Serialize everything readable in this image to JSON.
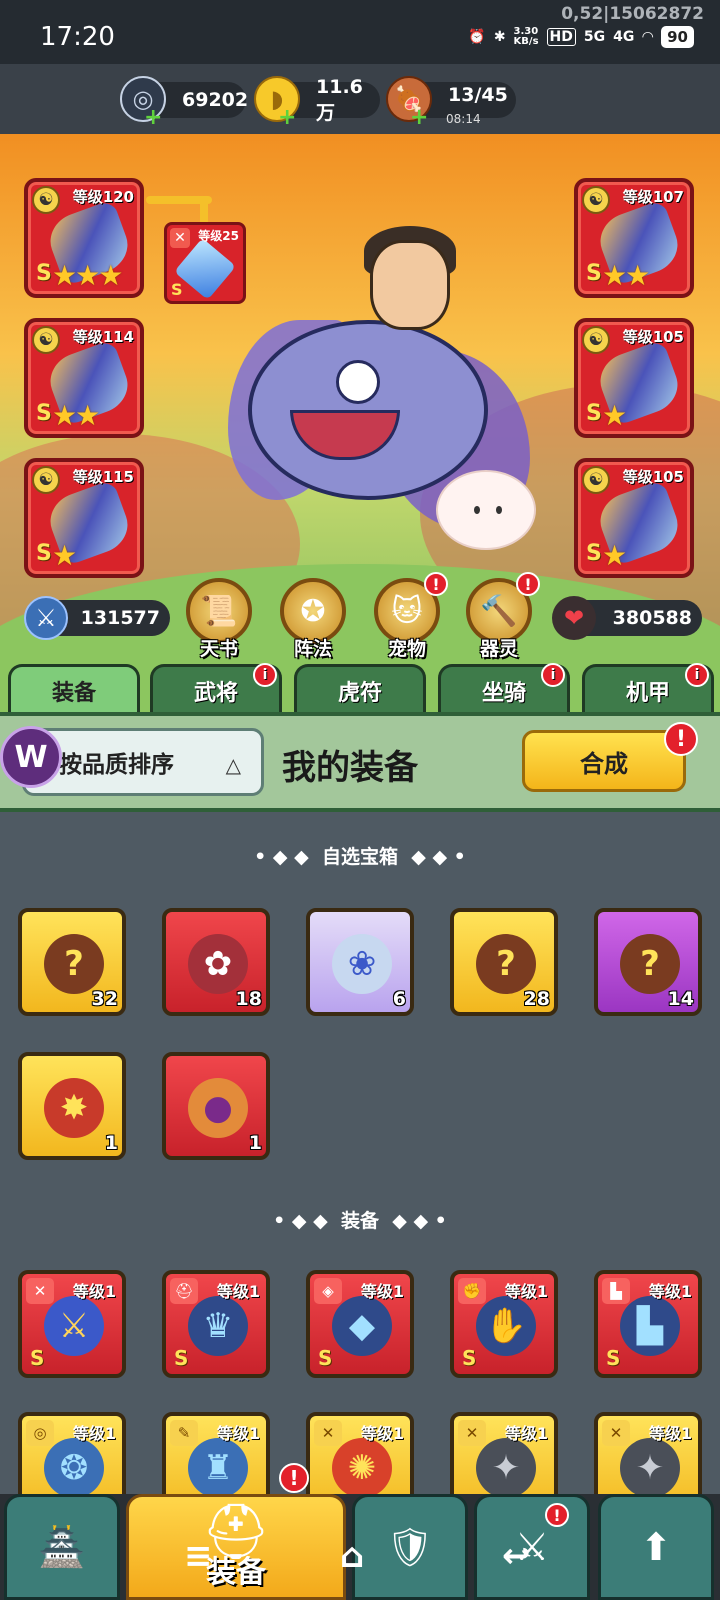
{
  "status_bar": {
    "time": "17:20",
    "speed": "3.30\nKB/s",
    "hd": "HD",
    "net5g": "5G",
    "net4g": "4G",
    "battery": "90",
    "debug": "0,52|15062872"
  },
  "resources": [
    {
      "name": "silver-coin",
      "value": "69202",
      "sub": ""
    },
    {
      "name": "gold-ingot",
      "value": "11.6万",
      "sub": ""
    },
    {
      "name": "meat-stamina",
      "value": "13/45",
      "sub": "08:14"
    }
  ],
  "equipment_slots": [
    {
      "level": "等级120",
      "stars": "★★★",
      "grade": "S"
    },
    {
      "level": "等级114",
      "stars": "★★",
      "grade": "S"
    },
    {
      "level": "等级115",
      "stars": "★",
      "grade": "S"
    },
    {
      "level": "等级107",
      "stars": "★★",
      "grade": "S"
    },
    {
      "level": "等级105",
      "stars": "★",
      "grade": "S"
    },
    {
      "level": "等级105",
      "stars": "★",
      "grade": "S"
    }
  ],
  "gem_slot": {
    "level": "等级25",
    "grade": "S"
  },
  "attack_power": "131577",
  "hp": "380588",
  "quick_buttons": [
    {
      "label": "天书",
      "badge": false
    },
    {
      "label": "阵法",
      "badge": false
    },
    {
      "label": "宠物",
      "badge": true
    },
    {
      "label": "器灵",
      "badge": true
    }
  ],
  "tabs": [
    {
      "label": "装备",
      "active": true,
      "badge": false
    },
    {
      "label": "武将",
      "active": false,
      "badge": true
    },
    {
      "label": "虎符",
      "active": false,
      "badge": false
    },
    {
      "label": "坐骑",
      "active": false,
      "badge": true
    },
    {
      "label": "机甲",
      "active": false,
      "badge": true
    }
  ],
  "panel": {
    "sort_label": "按品质排序",
    "title": "我的装备",
    "synth_label": "合成",
    "logo": "W"
  },
  "section_chests": {
    "title": "自选宝箱"
  },
  "chests": [
    {
      "color": "y",
      "count": "32"
    },
    {
      "color": "r",
      "count": "18"
    },
    {
      "color": "p",
      "count": "6"
    },
    {
      "color": "y",
      "count": "28"
    },
    {
      "color": "pu",
      "count": "14"
    },
    {
      "color": "y",
      "count": "1"
    },
    {
      "color": "r",
      "count": "1"
    }
  ],
  "section_equip": {
    "title": "装备"
  },
  "equipment_items": [
    {
      "color": "r",
      "level": "等级1",
      "grade": "S"
    },
    {
      "color": "r",
      "level": "等级1",
      "grade": "S"
    },
    {
      "color": "r",
      "level": "等级1",
      "grade": "S"
    },
    {
      "color": "r",
      "level": "等级1",
      "grade": "S"
    },
    {
      "color": "r",
      "level": "等级1",
      "grade": "S"
    },
    {
      "color": "y",
      "level": "等级1",
      "grade": ""
    },
    {
      "color": "y",
      "level": "等级1",
      "grade": ""
    },
    {
      "color": "y",
      "level": "等级1",
      "grade": ""
    },
    {
      "color": "y",
      "level": "等级1",
      "grade": ""
    },
    {
      "color": "y",
      "level": "等级1",
      "grade": ""
    }
  ],
  "bottom_nav": {
    "active_label": "装备"
  },
  "colors": {
    "accent_green": "#7fcc7a",
    "gold": "#f4b51a",
    "red_card": "#d8232a"
  }
}
